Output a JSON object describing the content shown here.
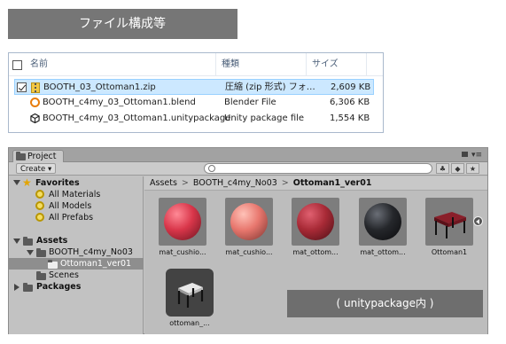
{
  "banner": {
    "title": "ファイル構成等"
  },
  "explorer": {
    "columns": {
      "name": "名前",
      "type": "種類",
      "size": "サイズ"
    },
    "files": [
      {
        "name": "BOOTH_03_Ottoman1.zip",
        "type": "圧縮 (zip 形式) フォ…",
        "size": "2,609 KB",
        "icon": "zip-folder-icon",
        "selected": true,
        "checked": true
      },
      {
        "name": "BOOTH_c4my_03_Ottoman1.blend",
        "type": "Blender File",
        "size": "6,306 KB",
        "icon": "blender-icon",
        "selected": false
      },
      {
        "name": "BOOTH_c4my_03_Ottoman1.unitypackage",
        "type": "Unity package file",
        "size": "1,554 KB",
        "icon": "unity-icon",
        "selected": false
      }
    ]
  },
  "unity": {
    "tab": "Project",
    "toolbar": {
      "create": "Create ▾"
    },
    "tree": {
      "favorites": "Favorites",
      "all_materials": "All Materials",
      "all_models": "All Models",
      "all_prefabs": "All Prefabs",
      "assets": "Assets",
      "booth_folder": "BOOTH_c4my_No03",
      "ottoman_folder": "Ottoman1_ver01",
      "scenes": "Scenes",
      "packages": "Packages"
    },
    "breadcrumb": {
      "assets": "Assets",
      "booth": "BOOTH_c4my_No03",
      "current": "Ottoman1_ver01",
      "separator": ">"
    },
    "assets": [
      {
        "label": "mat_cushio...",
        "color": "#d9364a"
      },
      {
        "label": "mat_cushio...",
        "color": "#e8776e"
      },
      {
        "label": "mat_ottom...",
        "color": "#a82a36"
      },
      {
        "label": "mat_ottom...",
        "color": "#25272b"
      },
      {
        "label": "Ottoman1",
        "color": "#8a1f2a"
      },
      {
        "label": "ottoman_...",
        "color": "#1a1a1a"
      }
    ]
  },
  "note": {
    "text": "( unitypackage内 )"
  }
}
